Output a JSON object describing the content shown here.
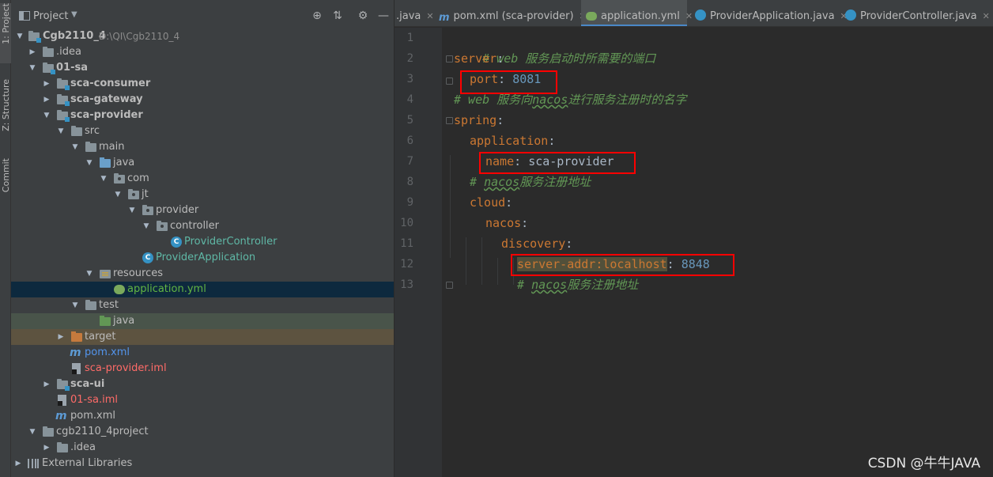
{
  "toolstrip": {
    "tabs": [
      "1: Project",
      "Z: Structure",
      "Commit"
    ]
  },
  "project_panel": {
    "title": "Project",
    "tree": [
      {
        "label": "Cgb2110_4",
        "hint": "D:\\QI\\Cgb2110_4"
      },
      {
        "label": ".idea"
      },
      {
        "label": "01-sa"
      },
      {
        "label": "sca-consumer"
      },
      {
        "label": "sca-gateway"
      },
      {
        "label": "sca-provider"
      },
      {
        "label": "src"
      },
      {
        "label": "main"
      },
      {
        "label": "java"
      },
      {
        "label": "com"
      },
      {
        "label": "jt"
      },
      {
        "label": "provider"
      },
      {
        "label": "controller"
      },
      {
        "label": "ProviderController"
      },
      {
        "label": "ProviderApplication"
      },
      {
        "label": "resources"
      },
      {
        "label": "application.yml"
      },
      {
        "label": "test"
      },
      {
        "label": "java"
      },
      {
        "label": "target"
      },
      {
        "label": "pom.xml"
      },
      {
        "label": "sca-provider.iml"
      },
      {
        "label": "sca-ui"
      },
      {
        "label": "01-sa.iml"
      },
      {
        "label": "pom.xml"
      },
      {
        "label": "cgb2110_4project"
      },
      {
        "label": ".idea"
      },
      {
        "label": "External Libraries"
      }
    ]
  },
  "editor": {
    "tabs": [
      {
        "label": ".java"
      },
      {
        "label": "pom.xml (sca-provider)"
      },
      {
        "label": "application.yml"
      },
      {
        "label": "ProviderApplication.java"
      },
      {
        "label": "ProviderController.java"
      }
    ],
    "lines": [
      {
        "num": "1",
        "comment": "# web 服务启动时所需要的端口"
      },
      {
        "num": "2",
        "key": "server",
        "punct": ":"
      },
      {
        "num": "3",
        "key": "port",
        "punct": ": ",
        "value": "8081"
      },
      {
        "num": "4",
        "c1": "# web 服务向",
        "c2": "nacos",
        "c3": "进行服务注册时的名字"
      },
      {
        "num": "5",
        "key": "spring",
        "punct": ":"
      },
      {
        "num": "6",
        "key": "application",
        "punct": ":"
      },
      {
        "num": "7",
        "key": "name",
        "punct": ": ",
        "value": "sca-provider"
      },
      {
        "num": "8",
        "c1": "# ",
        "c2": "nacos",
        "c3": "服务注册地址"
      },
      {
        "num": "9",
        "key": "cloud",
        "punct": ":"
      },
      {
        "num": "10",
        "key": "nacos",
        "punct": ":"
      },
      {
        "num": "11",
        "key": "discovery",
        "punct": ":"
      },
      {
        "num": "12",
        "key": "server-addr:localhost",
        "punct": ": ",
        "value": "8848"
      },
      {
        "num": "13",
        "c1": "# ",
        "c2": "nacos",
        "c3": "服务注册地址"
      }
    ]
  },
  "watermark": "CSDN @牛牛JAVA",
  "colors": {
    "comment": "#629755",
    "key": "#cc7832",
    "number": "#6897bb",
    "annotation_box": "#ff0000",
    "selection": "#0d293e"
  }
}
